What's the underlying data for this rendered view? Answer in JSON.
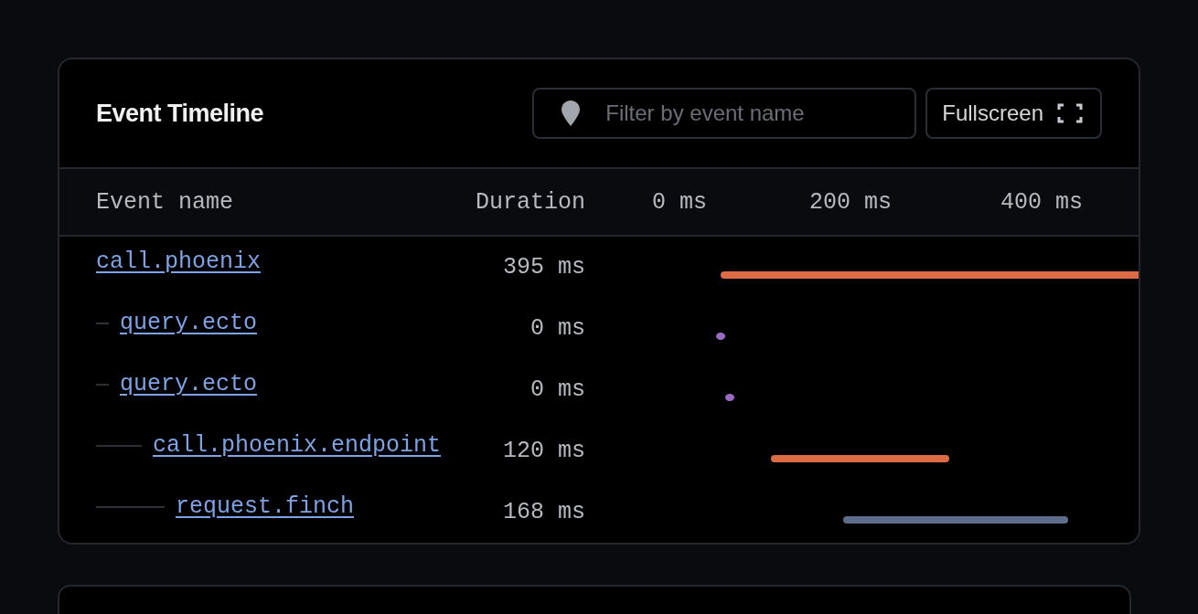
{
  "panel": {
    "title": "Event Timeline",
    "filter": {
      "placeholder": "Filter by event name"
    },
    "fullscreen_button": "Fullscreen"
  },
  "table": {
    "columns": [
      "Event name",
      "Duration"
    ],
    "timeline_ticks": [
      "0 ms",
      "200 ms",
      "400 ms"
    ],
    "rows": [
      {
        "name": "call.phoenix",
        "duration": "395 ms",
        "color": "#dc6b45",
        "children": [
          {
            "name": "query.ecto",
            "duration": "0 ms",
            "color": "#9b6bc4"
          },
          {
            "name": "query.ecto",
            "duration": "0 ms",
            "color": "#9b6bc4",
            "children": [
              {
                "name": "call.phoenix.endpoint",
                "duration": "120 ms",
                "color": "#dc6b45",
                "children": [
                  {
                    "name": "request.finch",
                    "duration": "168 ms",
                    "color": "#5f6d8c"
                  }
                ]
              }
            ]
          }
        ]
      }
    ]
  },
  "next_panel": {
    "kind": "empty"
  }
}
